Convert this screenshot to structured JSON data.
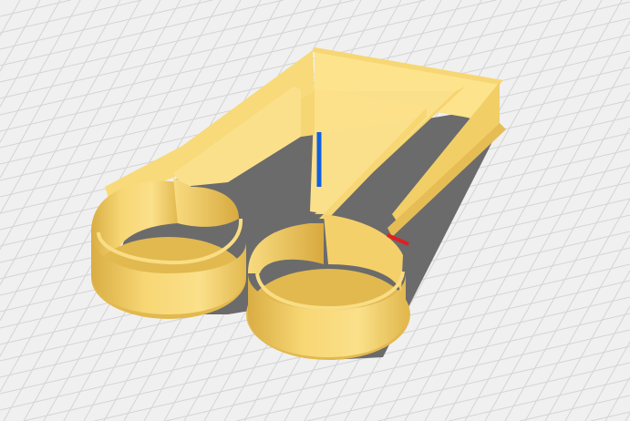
{
  "viewport": {
    "background_color": "#f0f0f0",
    "grid_color": "#d4d4d4",
    "model_color": "#f7d774",
    "model_shade_color": "#e2b94f",
    "model_dark_color": "#c99a32",
    "shadow_color": "#6b6b6b",
    "axes": {
      "x_color": "#e02020",
      "z_color": "#1060e0"
    }
  }
}
